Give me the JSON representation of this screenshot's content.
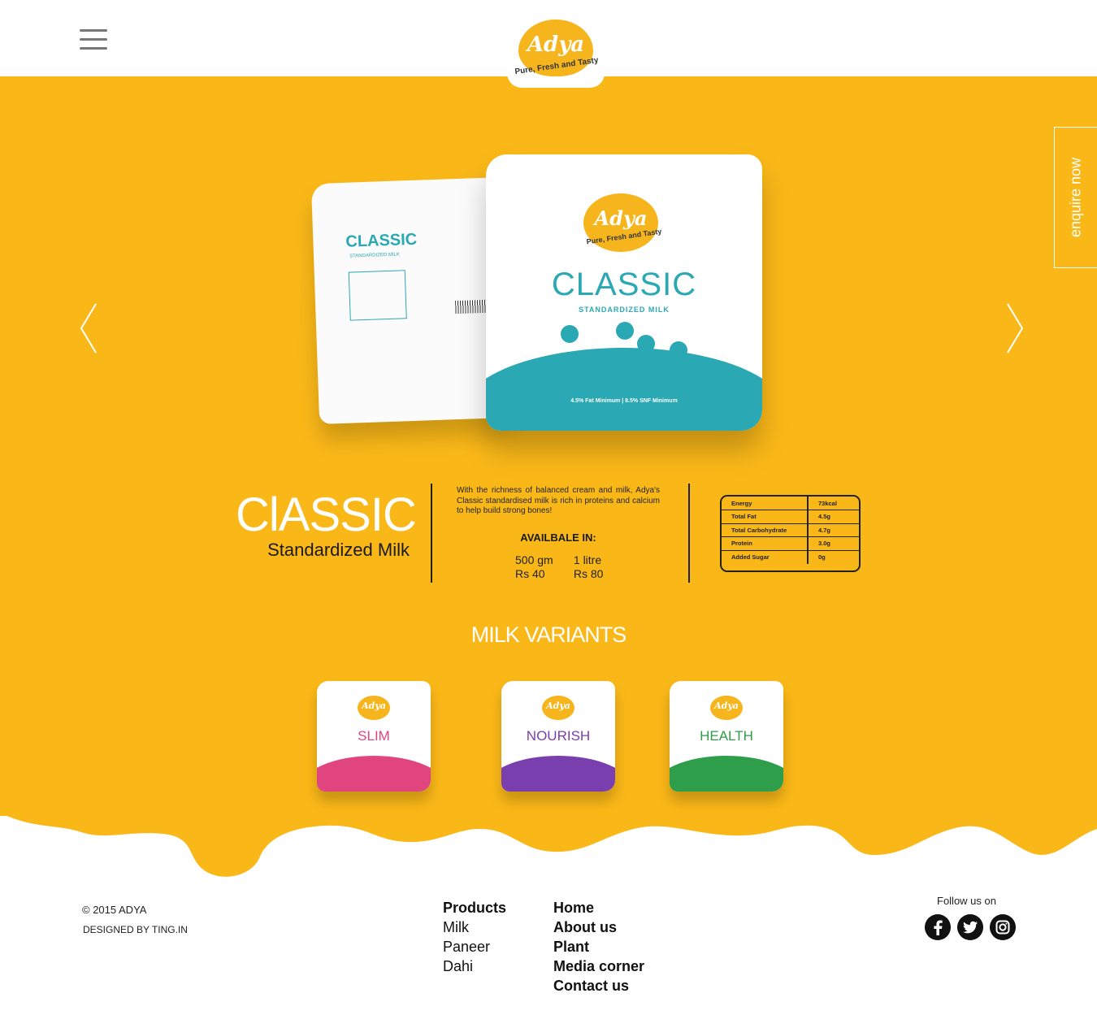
{
  "header": {
    "logo_text": "Adya",
    "logo_tagline": "Pure, Fresh and Tasty",
    "menu_icon": "hamburger-menu-icon"
  },
  "hero": {
    "pack_back_title": "CLASSIC",
    "pack_back_sub": "STANDARDIZED MILK",
    "pack_front_logo": "Adya",
    "pack_front_tagline": "Pure, Fresh and Tasty",
    "pack_front_title": "CLASSIC",
    "pack_front_sub": "STANDARDIZED MILK",
    "pack_front_info": "4.5% Fat Minimum | 8.5% SNF Minimum",
    "prev_icon": "chevron-left-icon",
    "next_icon": "chevron-right-icon",
    "enquire_label": "enquire now"
  },
  "product": {
    "title": "ClASSIC",
    "subtitle": "Standardized Milk",
    "description": "With the richness of balanced cream and milk, Adya's Classic standardised milk is rich in proteins and calcium to help build strong bones!",
    "available_heading": "AVAILBALE IN:",
    "sizes": [
      {
        "size": "500 gm",
        "price": "Rs 40"
      },
      {
        "size": "1 litre",
        "price": "Rs 80"
      }
    ],
    "nutrition": [
      {
        "name": "Energy",
        "value": "73kcal"
      },
      {
        "name": "Total Fat",
        "value": "4.5g"
      },
      {
        "name": "Total Carbohydrate",
        "value": "4.7g"
      },
      {
        "name": "Protein",
        "value": "3.0g"
      },
      {
        "name": "Added Sugar",
        "value": "0g"
      }
    ]
  },
  "variants": {
    "heading": "MILK VARIANTS",
    "items": [
      {
        "name": "SLIM",
        "color": "#e0457f"
      },
      {
        "name": "NOURISH",
        "color": "#7a3fae"
      },
      {
        "name": "HEALTH",
        "color": "#2e9e4a"
      }
    ],
    "logo_text": "Adya"
  },
  "footer": {
    "copyright": "© 2015 ADYA",
    "designed_by": "DESIGNED BY TING.IN",
    "products": [
      "Products",
      "Milk",
      "Paneer",
      "Dahi"
    ],
    "nav": [
      "Home",
      "About us",
      "Plant",
      "Media corner",
      "Contact us"
    ],
    "follow_label": "Follow us on",
    "social_icons": [
      "facebook-icon",
      "twitter-icon",
      "instagram-icon"
    ]
  },
  "colors": {
    "brand_yellow": "#fab818",
    "pack_teal": "#2aa8b4"
  }
}
